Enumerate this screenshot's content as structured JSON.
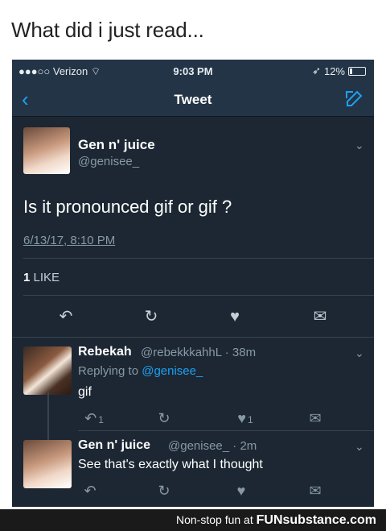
{
  "caption": "What did i just read...",
  "status_bar": {
    "carrier": "●●●○○ Verizon",
    "time": "9:03 PM",
    "battery": "12%"
  },
  "nav": {
    "title": "Tweet"
  },
  "tweet": {
    "name": "Gen n' juice",
    "handle": "@genisee_",
    "text": "Is it pronounced gif or gif ?",
    "timestamp": "6/13/17, 8:10 PM",
    "likes_count": "1",
    "likes_label": "LIKE"
  },
  "replies": [
    {
      "name": "Rebekah",
      "handle_time": "@rebekkkahhL · 38m",
      "replying_prefix": "Replying to",
      "replying_to": "@genisee_",
      "text": "gif",
      "reply_count": "1",
      "like_count": "1"
    },
    {
      "name": "Gen n' juice",
      "handle_time": "@genisee_ · 2m",
      "text": "See that's exactly what I thought"
    }
  ],
  "footer": {
    "tagline": "Non-stop fun at",
    "brand": "FUNsubstance.com"
  },
  "colors": {
    "background": "#1c2733",
    "accent": "#1da1f2",
    "muted": "#8899a6"
  }
}
